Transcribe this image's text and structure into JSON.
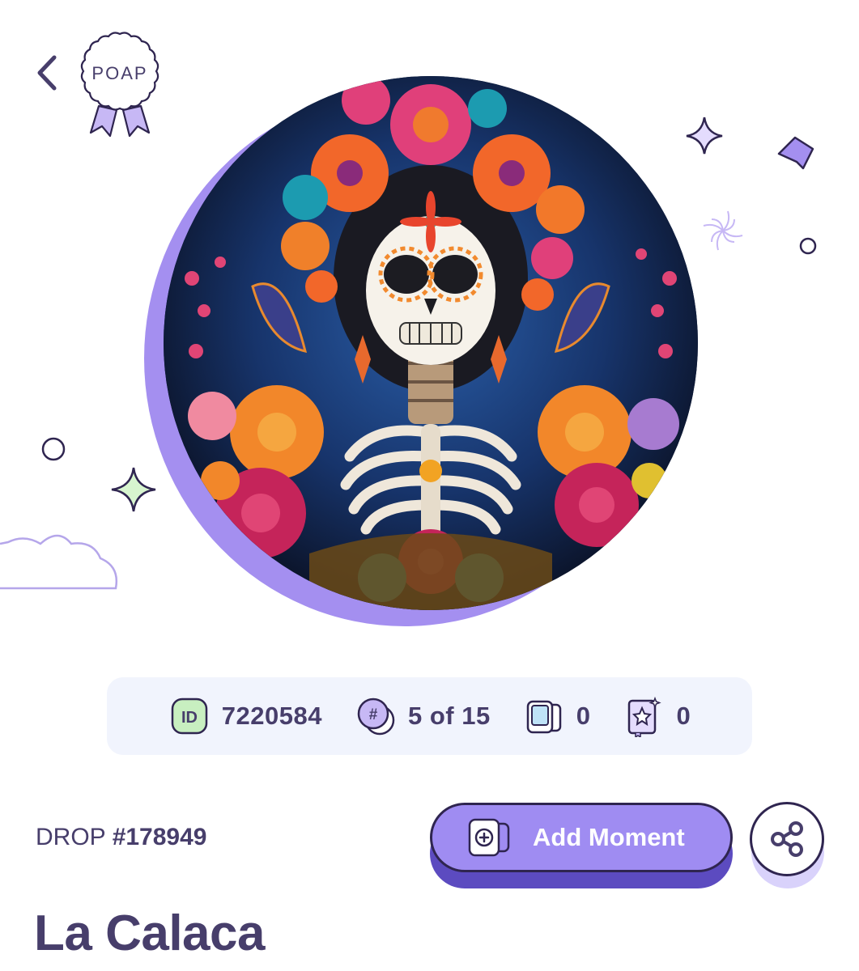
{
  "header": {
    "logo_text": "POAP",
    "back_icon": "chevron-left-icon"
  },
  "stats": {
    "token_id": "7220584",
    "mint_count": "5 of 15",
    "moments_count": "0",
    "collections_count": "0"
  },
  "drop": {
    "label": "DROP",
    "number": "#178949"
  },
  "actions": {
    "add_moment_label": "Add Moment",
    "share_icon": "share-icon"
  },
  "title": "La Calaca",
  "colors": {
    "accent": "#9f8cf2",
    "accent_dark": "#5c4bc0",
    "text": "#473e6b",
    "stats_bg": "#f1f4fd",
    "id_badge": "#c8efc0",
    "hash_badge": "#c7b8f5"
  }
}
